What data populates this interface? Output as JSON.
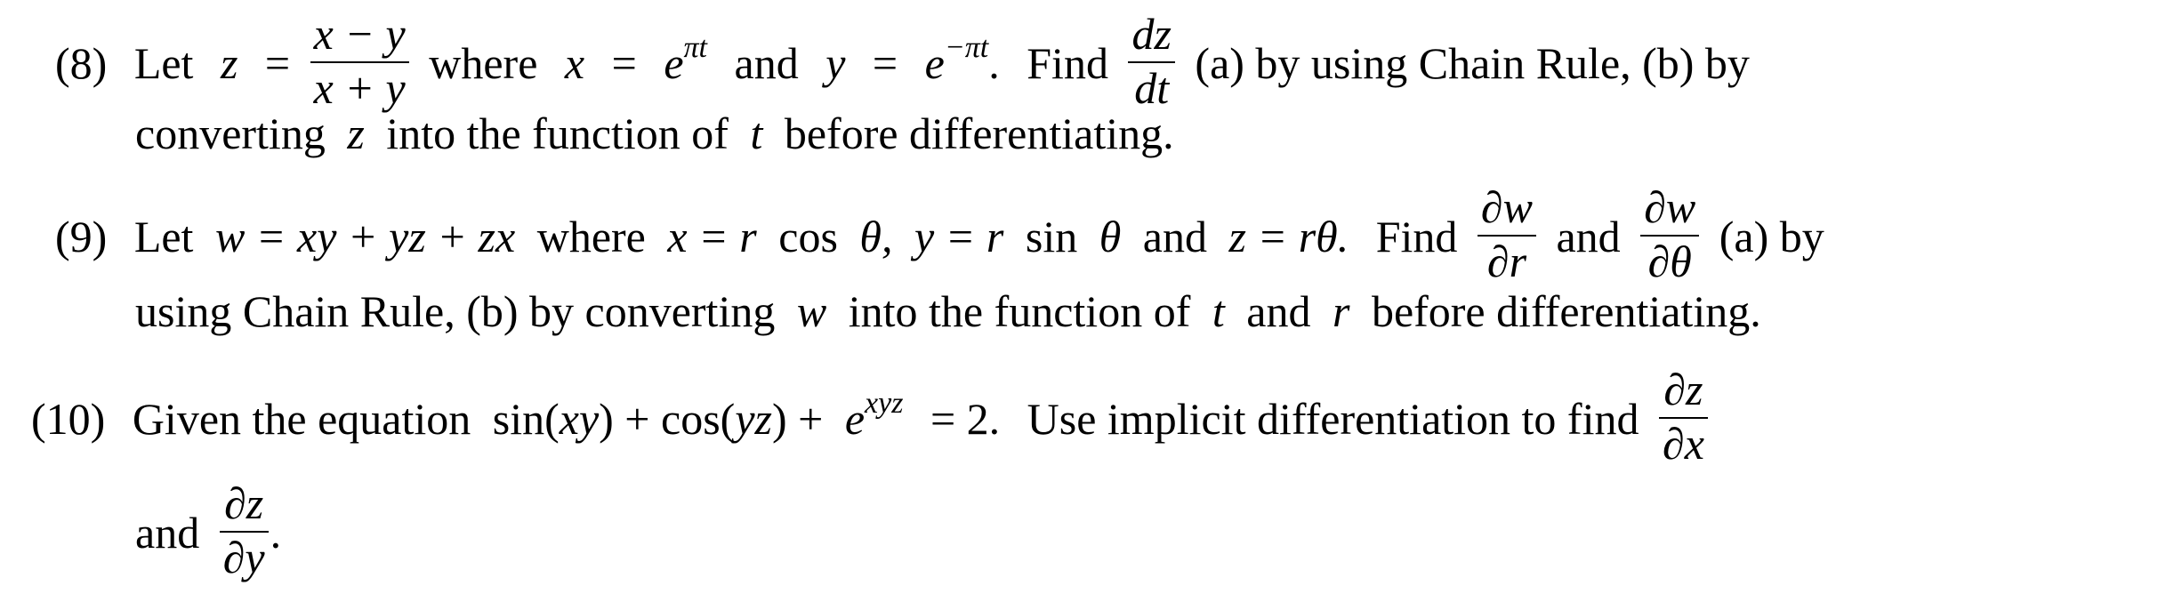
{
  "problems": [
    {
      "number": "(8)",
      "line1": {
        "let": "Let",
        "z_var": "z",
        "eq": "=",
        "frac_num": "x − y",
        "frac_den": "x + y",
        "where": "where",
        "x_var": "x",
        "eq2": "=",
        "exp_base1": "e",
        "exp_sup1": "πt",
        "and": "and",
        "y_var": "y",
        "eq3": "=",
        "exp_base2": "e",
        "exp_sup2": "−πt",
        "period": ".",
        "find": "Find",
        "deriv_num": "dz",
        "deriv_den": "dt",
        "tail": "(a) by using Chain Rule, (b) by"
      },
      "line2": {
        "pre": "converting",
        "var_z": "z",
        "mid": "into the function of",
        "var_t": "t",
        "post": "before differentiating."
      }
    },
    {
      "number": "(9)",
      "line1": {
        "let": "Let",
        "w_expr": "w = xy + yz + zx",
        "where": "where",
        "x_part_var": "x = r",
        "x_part_fn": "cos",
        "x_part_theta": "θ,",
        "y_part_var": "y = r",
        "y_part_fn": "sin",
        "y_part_theta": "θ",
        "and": "and",
        "z_part": "z = rθ.",
        "find": "Find",
        "frac1_num": "∂w",
        "frac1_den": "∂r",
        "and2": "and",
        "frac2_num": "∂w",
        "frac2_den": "∂θ",
        "tail": "(a) by"
      },
      "line2": {
        "pre": "using Chain Rule, (b) by converting",
        "var_w": "w",
        "mid": "into the function of",
        "var_t": "t",
        "and": "and",
        "var_r": "r",
        "post": "before differentiating."
      }
    },
    {
      "number": "(10)",
      "line1": {
        "pre": "Given the equation",
        "sin": "sin(",
        "sin_arg": "xy",
        "sin_close": ") + cos(",
        "cos_arg": "yz",
        "cos_close": ") +",
        "exp_base": "e",
        "exp_sup": "xyz",
        "eq": "= 2.",
        "post": "Use implicit differentiation to find",
        "frac_num": "∂z",
        "frac_den": "∂x"
      },
      "line2": {
        "and": "and",
        "frac_num": "∂z",
        "frac_den": "∂y",
        "period": "."
      }
    }
  ]
}
